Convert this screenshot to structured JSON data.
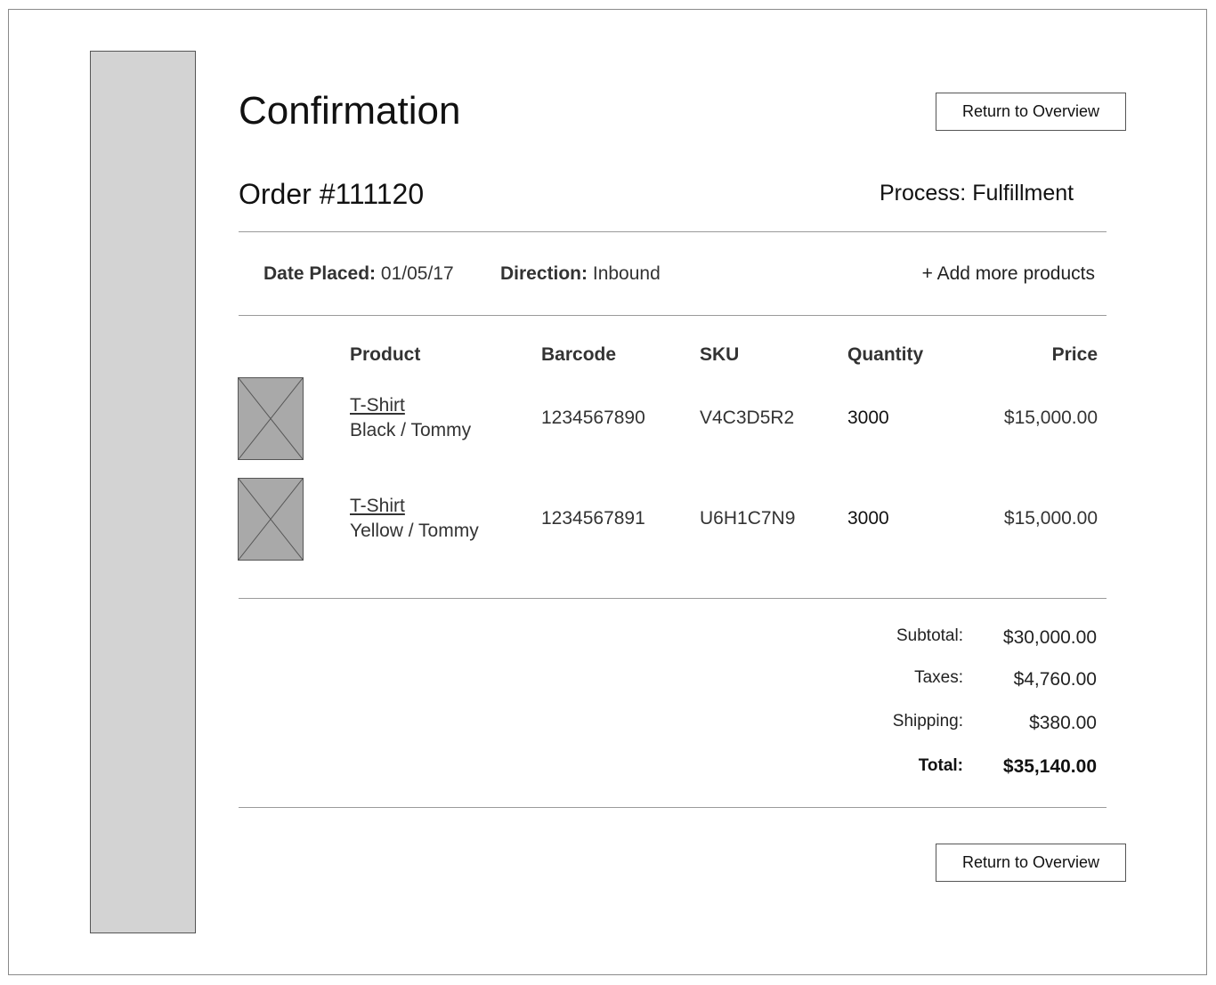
{
  "header": {
    "title": "Confirmation",
    "return_button_label": "Return to Overview"
  },
  "order": {
    "number_label": "Order #111120",
    "process_label": "Process: Fulfillment",
    "date_placed_label": "Date Placed:",
    "date_placed_value": "01/05/17",
    "direction_label": "Direction:",
    "direction_value": "Inbound",
    "add_more_label": "+ Add more products"
  },
  "table": {
    "headers": {
      "product": "Product",
      "barcode": "Barcode",
      "sku": "SKU",
      "quantity": "Quantity",
      "price": "Price"
    },
    "rows": [
      {
        "name": "T-Shirt",
        "variant": "Black / Tommy",
        "barcode": "1234567890",
        "sku": "V4C3D5R2",
        "quantity": "3000",
        "price": "$15,000.00",
        "image": "image-placeholder-icon"
      },
      {
        "name": "T-Shirt",
        "variant": "Yellow / Tommy",
        "barcode": "1234567891",
        "sku": "U6H1C7N9",
        "quantity": "3000",
        "price": "$15,000.00",
        "image": "image-placeholder-icon"
      }
    ]
  },
  "summary": {
    "subtotal_label": "Subtotal:",
    "subtotal_value": "$30,000.00",
    "taxes_label": "Taxes:",
    "taxes_value": "$4,760.00",
    "shipping_label": "Shipping:",
    "shipping_value": "$380.00",
    "total_label": "Total:",
    "total_value": "$35,140.00"
  },
  "footer": {
    "return_button_label": "Return to Overview"
  }
}
